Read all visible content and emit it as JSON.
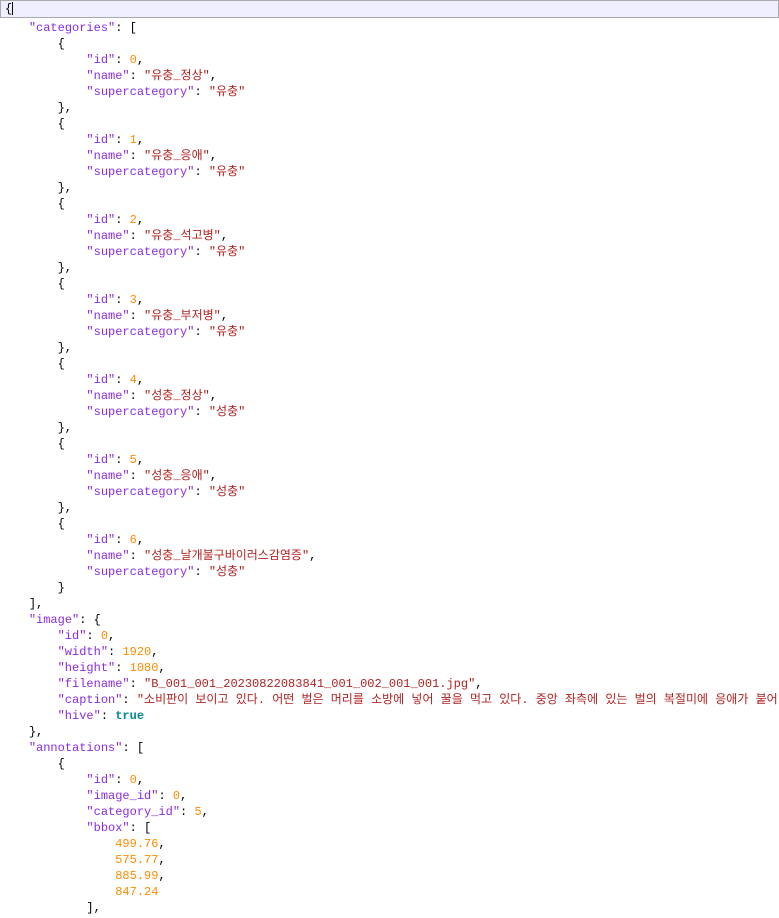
{
  "topbar": {
    "first_char": "{"
  },
  "lines": [
    {
      "indent": 4,
      "segs": [
        {
          "c": "k",
          "t": "\"categories\""
        },
        {
          "c": "p",
          "t": ": ["
        }
      ]
    },
    {
      "indent": 8,
      "segs": [
        {
          "c": "p",
          "t": "{"
        }
      ]
    },
    {
      "indent": 12,
      "segs": [
        {
          "c": "k",
          "t": "\"id\""
        },
        {
          "c": "p",
          "t": ": "
        },
        {
          "c": "n",
          "t": "0"
        },
        {
          "c": "p",
          "t": ","
        }
      ]
    },
    {
      "indent": 12,
      "segs": [
        {
          "c": "k",
          "t": "\"name\""
        },
        {
          "c": "p",
          "t": ": "
        },
        {
          "c": "s",
          "t": "\"유충_정상\""
        },
        {
          "c": "p",
          "t": ","
        }
      ]
    },
    {
      "indent": 12,
      "segs": [
        {
          "c": "k",
          "t": "\"supercategory\""
        },
        {
          "c": "p",
          "t": ": "
        },
        {
          "c": "s",
          "t": "\"유충\""
        }
      ]
    },
    {
      "indent": 8,
      "segs": [
        {
          "c": "p",
          "t": "},"
        }
      ]
    },
    {
      "indent": 8,
      "segs": [
        {
          "c": "p",
          "t": "{"
        }
      ]
    },
    {
      "indent": 12,
      "segs": [
        {
          "c": "k",
          "t": "\"id\""
        },
        {
          "c": "p",
          "t": ": "
        },
        {
          "c": "n",
          "t": "1"
        },
        {
          "c": "p",
          "t": ","
        }
      ]
    },
    {
      "indent": 12,
      "segs": [
        {
          "c": "k",
          "t": "\"name\""
        },
        {
          "c": "p",
          "t": ": "
        },
        {
          "c": "s",
          "t": "\"유충_응애\""
        },
        {
          "c": "p",
          "t": ","
        }
      ]
    },
    {
      "indent": 12,
      "segs": [
        {
          "c": "k",
          "t": "\"supercategory\""
        },
        {
          "c": "p",
          "t": ": "
        },
        {
          "c": "s",
          "t": "\"유충\""
        }
      ]
    },
    {
      "indent": 8,
      "segs": [
        {
          "c": "p",
          "t": "},"
        }
      ]
    },
    {
      "indent": 8,
      "segs": [
        {
          "c": "p",
          "t": "{"
        }
      ]
    },
    {
      "indent": 12,
      "segs": [
        {
          "c": "k",
          "t": "\"id\""
        },
        {
          "c": "p",
          "t": ": "
        },
        {
          "c": "n",
          "t": "2"
        },
        {
          "c": "p",
          "t": ","
        }
      ]
    },
    {
      "indent": 12,
      "segs": [
        {
          "c": "k",
          "t": "\"name\""
        },
        {
          "c": "p",
          "t": ": "
        },
        {
          "c": "s",
          "t": "\"유충_석고병\""
        },
        {
          "c": "p",
          "t": ","
        }
      ]
    },
    {
      "indent": 12,
      "segs": [
        {
          "c": "k",
          "t": "\"supercategory\""
        },
        {
          "c": "p",
          "t": ": "
        },
        {
          "c": "s",
          "t": "\"유충\""
        }
      ]
    },
    {
      "indent": 8,
      "segs": [
        {
          "c": "p",
          "t": "},"
        }
      ]
    },
    {
      "indent": 8,
      "segs": [
        {
          "c": "p",
          "t": "{"
        }
      ]
    },
    {
      "indent": 12,
      "segs": [
        {
          "c": "k",
          "t": "\"id\""
        },
        {
          "c": "p",
          "t": ": "
        },
        {
          "c": "n",
          "t": "3"
        },
        {
          "c": "p",
          "t": ","
        }
      ]
    },
    {
      "indent": 12,
      "segs": [
        {
          "c": "k",
          "t": "\"name\""
        },
        {
          "c": "p",
          "t": ": "
        },
        {
          "c": "s",
          "t": "\"유충_부저병\""
        },
        {
          "c": "p",
          "t": ","
        }
      ]
    },
    {
      "indent": 12,
      "segs": [
        {
          "c": "k",
          "t": "\"supercategory\""
        },
        {
          "c": "p",
          "t": ": "
        },
        {
          "c": "s",
          "t": "\"유충\""
        }
      ]
    },
    {
      "indent": 8,
      "segs": [
        {
          "c": "p",
          "t": "},"
        }
      ]
    },
    {
      "indent": 8,
      "segs": [
        {
          "c": "p",
          "t": "{"
        }
      ]
    },
    {
      "indent": 12,
      "segs": [
        {
          "c": "k",
          "t": "\"id\""
        },
        {
          "c": "p",
          "t": ": "
        },
        {
          "c": "n",
          "t": "4"
        },
        {
          "c": "p",
          "t": ","
        }
      ]
    },
    {
      "indent": 12,
      "segs": [
        {
          "c": "k",
          "t": "\"name\""
        },
        {
          "c": "p",
          "t": ": "
        },
        {
          "c": "s",
          "t": "\"성충_정상\""
        },
        {
          "c": "p",
          "t": ","
        }
      ]
    },
    {
      "indent": 12,
      "segs": [
        {
          "c": "k",
          "t": "\"supercategory\""
        },
        {
          "c": "p",
          "t": ": "
        },
        {
          "c": "s",
          "t": "\"성충\""
        }
      ]
    },
    {
      "indent": 8,
      "segs": [
        {
          "c": "p",
          "t": "},"
        }
      ]
    },
    {
      "indent": 8,
      "segs": [
        {
          "c": "p",
          "t": "{"
        }
      ]
    },
    {
      "indent": 12,
      "segs": [
        {
          "c": "k",
          "t": "\"id\""
        },
        {
          "c": "p",
          "t": ": "
        },
        {
          "c": "n",
          "t": "5"
        },
        {
          "c": "p",
          "t": ","
        }
      ]
    },
    {
      "indent": 12,
      "segs": [
        {
          "c": "k",
          "t": "\"name\""
        },
        {
          "c": "p",
          "t": ": "
        },
        {
          "c": "s",
          "t": "\"성충_응애\""
        },
        {
          "c": "p",
          "t": ","
        }
      ]
    },
    {
      "indent": 12,
      "segs": [
        {
          "c": "k",
          "t": "\"supercategory\""
        },
        {
          "c": "p",
          "t": ": "
        },
        {
          "c": "s",
          "t": "\"성충\""
        }
      ]
    },
    {
      "indent": 8,
      "segs": [
        {
          "c": "p",
          "t": "},"
        }
      ]
    },
    {
      "indent": 8,
      "segs": [
        {
          "c": "p",
          "t": "{"
        }
      ]
    },
    {
      "indent": 12,
      "segs": [
        {
          "c": "k",
          "t": "\"id\""
        },
        {
          "c": "p",
          "t": ": "
        },
        {
          "c": "n",
          "t": "6"
        },
        {
          "c": "p",
          "t": ","
        }
      ]
    },
    {
      "indent": 12,
      "segs": [
        {
          "c": "k",
          "t": "\"name\""
        },
        {
          "c": "p",
          "t": ": "
        },
        {
          "c": "s",
          "t": "\"성충_날개불구바이러스감염증\""
        },
        {
          "c": "p",
          "t": ","
        }
      ]
    },
    {
      "indent": 12,
      "segs": [
        {
          "c": "k",
          "t": "\"supercategory\""
        },
        {
          "c": "p",
          "t": ": "
        },
        {
          "c": "s",
          "t": "\"성충\""
        }
      ]
    },
    {
      "indent": 8,
      "segs": [
        {
          "c": "p",
          "t": "}"
        }
      ]
    },
    {
      "indent": 4,
      "segs": [
        {
          "c": "p",
          "t": "],"
        }
      ]
    },
    {
      "indent": 4,
      "segs": [
        {
          "c": "k",
          "t": "\"image\""
        },
        {
          "c": "p",
          "t": ": {"
        }
      ]
    },
    {
      "indent": 8,
      "segs": [
        {
          "c": "k",
          "t": "\"id\""
        },
        {
          "c": "p",
          "t": ": "
        },
        {
          "c": "n",
          "t": "0"
        },
        {
          "c": "p",
          "t": ","
        }
      ]
    },
    {
      "indent": 8,
      "segs": [
        {
          "c": "k",
          "t": "\"width\""
        },
        {
          "c": "p",
          "t": ": "
        },
        {
          "c": "n",
          "t": "1920"
        },
        {
          "c": "p",
          "t": ","
        }
      ]
    },
    {
      "indent": 8,
      "segs": [
        {
          "c": "k",
          "t": "\"height\""
        },
        {
          "c": "p",
          "t": ": "
        },
        {
          "c": "n",
          "t": "1080"
        },
        {
          "c": "p",
          "t": ","
        }
      ]
    },
    {
      "indent": 8,
      "segs": [
        {
          "c": "k",
          "t": "\"filename\""
        },
        {
          "c": "p",
          "t": ": "
        },
        {
          "c": "s",
          "t": "\"B_001_001_20230822083841_001_002_001_001.jpg\""
        },
        {
          "c": "p",
          "t": ","
        }
      ]
    },
    {
      "indent": 8,
      "segs": [
        {
          "c": "k",
          "t": "\"caption\""
        },
        {
          "c": "p",
          "t": ": "
        },
        {
          "c": "s",
          "t": "\"소비판이 보이고 있다. 어떤 벌은 머리를 소방에 넣어 꿀을 먹고 있다. 중앙 좌측에 있는 벌의 복절미에 응애가 붙어 있다. \""
        },
        {
          "c": "p",
          "t": ","
        }
      ]
    },
    {
      "indent": 8,
      "segs": [
        {
          "c": "k",
          "t": "\"hive\""
        },
        {
          "c": "p",
          "t": ": "
        },
        {
          "c": "t",
          "t": "true"
        }
      ]
    },
    {
      "indent": 4,
      "segs": [
        {
          "c": "p",
          "t": "},"
        }
      ]
    },
    {
      "indent": 4,
      "segs": [
        {
          "c": "k",
          "t": "\"annotations\""
        },
        {
          "c": "p",
          "t": ": ["
        }
      ]
    },
    {
      "indent": 8,
      "segs": [
        {
          "c": "p",
          "t": "{"
        }
      ]
    },
    {
      "indent": 12,
      "segs": [
        {
          "c": "k",
          "t": "\"id\""
        },
        {
          "c": "p",
          "t": ": "
        },
        {
          "c": "n",
          "t": "0"
        },
        {
          "c": "p",
          "t": ","
        }
      ]
    },
    {
      "indent": 12,
      "segs": [
        {
          "c": "k",
          "t": "\"image_id\""
        },
        {
          "c": "p",
          "t": ": "
        },
        {
          "c": "n",
          "t": "0"
        },
        {
          "c": "p",
          "t": ","
        }
      ]
    },
    {
      "indent": 12,
      "segs": [
        {
          "c": "k",
          "t": "\"category_id\""
        },
        {
          "c": "p",
          "t": ": "
        },
        {
          "c": "n",
          "t": "5"
        },
        {
          "c": "p",
          "t": ","
        }
      ]
    },
    {
      "indent": 12,
      "segs": [
        {
          "c": "k",
          "t": "\"bbox\""
        },
        {
          "c": "p",
          "t": ": ["
        }
      ]
    },
    {
      "indent": 16,
      "segs": [
        {
          "c": "n",
          "t": "499.76"
        },
        {
          "c": "p",
          "t": ","
        }
      ]
    },
    {
      "indent": 16,
      "segs": [
        {
          "c": "n",
          "t": "575.77"
        },
        {
          "c": "p",
          "t": ","
        }
      ]
    },
    {
      "indent": 16,
      "segs": [
        {
          "c": "n",
          "t": "885.99"
        },
        {
          "c": "p",
          "t": ","
        }
      ]
    },
    {
      "indent": 16,
      "segs": [
        {
          "c": "n",
          "t": "847.24"
        }
      ]
    },
    {
      "indent": 12,
      "segs": [
        {
          "c": "p",
          "t": "],"
        }
      ]
    }
  ]
}
